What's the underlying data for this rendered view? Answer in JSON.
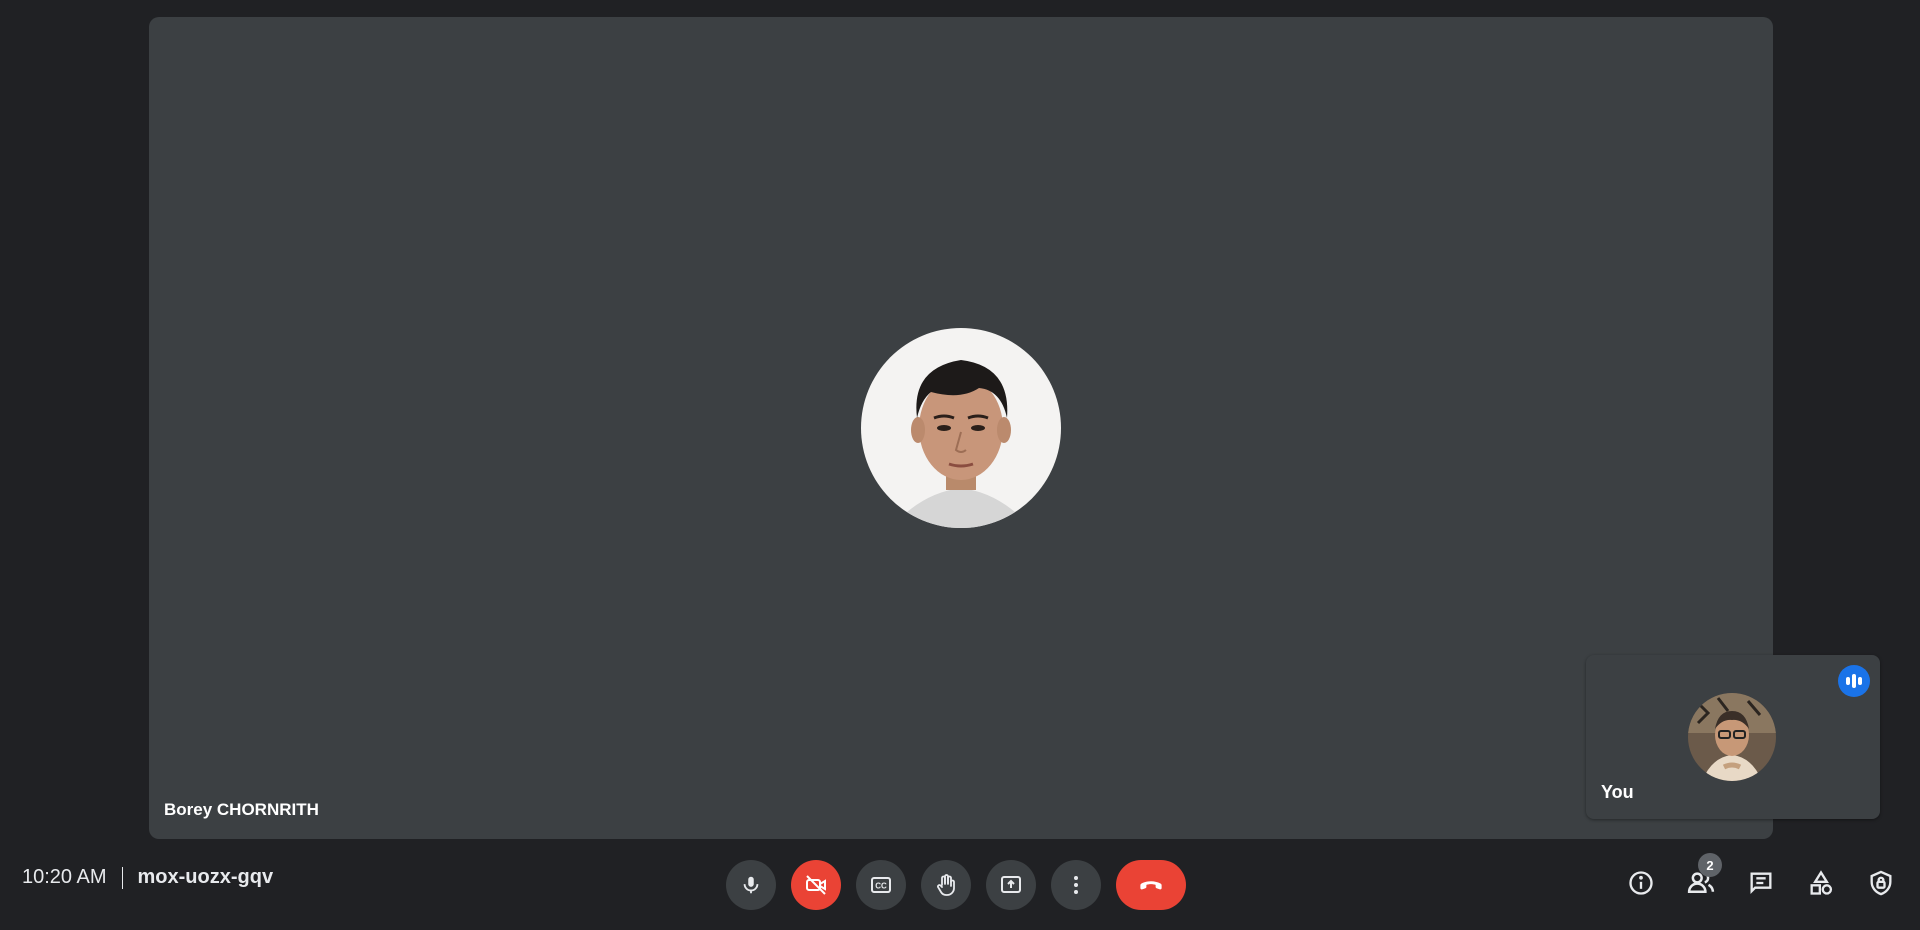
{
  "main_tile": {
    "participant_name": "Borey CHORNRITH"
  },
  "self_tile": {
    "label": "You"
  },
  "meeting": {
    "time": "10:20 AM",
    "code": "mox-uozx-gqv"
  },
  "participants": {
    "count": "2"
  },
  "controls": {
    "mic": "microphone-icon",
    "camera": "camera-off-icon",
    "captions": "captions-icon",
    "raise_hand": "hand-icon",
    "present": "present-screen-icon",
    "more": "more-options-icon",
    "leave": "hang-up-icon"
  },
  "colors": {
    "background": "#202124",
    "tile": "#3c4043",
    "danger": "#ea4335",
    "accent": "#1a73e8"
  }
}
